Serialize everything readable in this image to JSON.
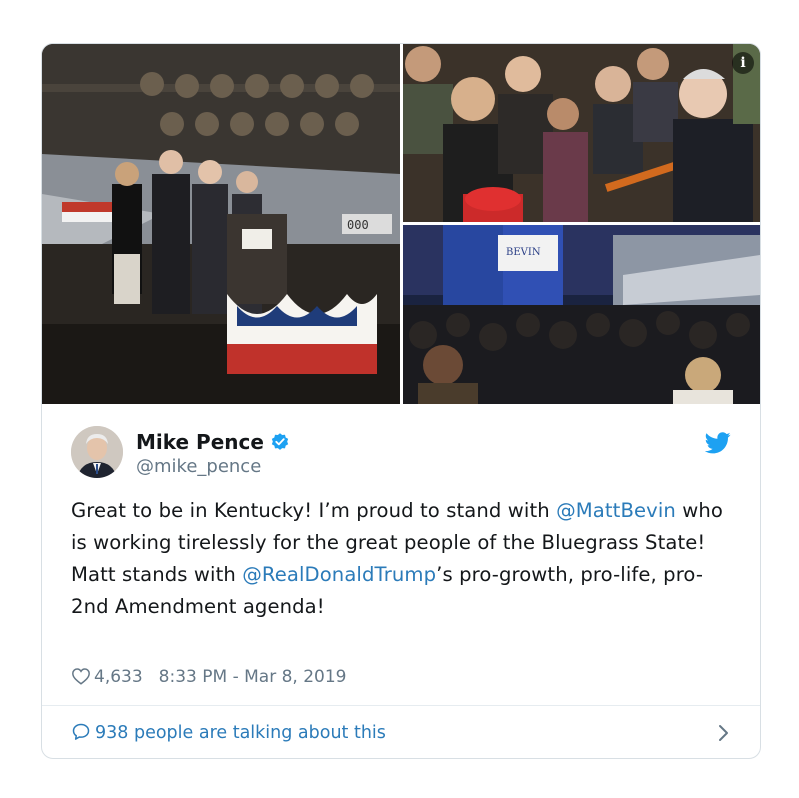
{
  "tweet": {
    "author_name": "Mike Pence",
    "author_handle": "@mike_pence",
    "text_parts": [
      "Great to be in Kentucky! I’m proud to stand with ",
      "@MattBevin",
      " who is working tirelessly for the great people of the Bluegrass State! Matt stands with ",
      "@RealDonaldTrump",
      "’s pro-growth, pro-life, pro-2nd Amendment agenda!"
    ],
    "likes": "4,633",
    "timestamp": "8:33 PM - Mar 8, 2019",
    "talking": "938 people are talking about this"
  },
  "media": {
    "photo1": "stage-rally-photo",
    "photo2": "crowd-greeting-photo",
    "photo3": "hangar-audience-photo",
    "info_glyph": "i",
    "banner_text": "BEVIN",
    "podium_text": "000"
  },
  "icons": {
    "verified": "verified-badge-icon",
    "twitter": "twitter-bird-icon",
    "heart": "heart-icon",
    "bubble": "speech-bubble-icon",
    "chevron": "chevron-right-icon"
  },
  "colors": {
    "twitter_blue": "#1da1f2",
    "link_blue": "#2b7bb9",
    "muted_gray": "#657786",
    "text_dark": "#14171a",
    "border": "#d8dfe4"
  }
}
